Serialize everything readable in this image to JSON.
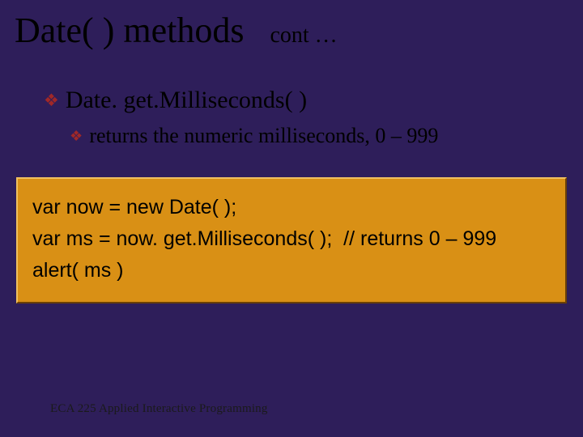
{
  "title": "Date( ) methods",
  "title_cont": "cont …",
  "bullet1": "Date. get.Milliseconds( )",
  "bullet2": "returns the numeric milliseconds, 0 – 999",
  "code": {
    "line1": "var now = new Date( );",
    "line2": "var ms = now. get.Milliseconds( );  // returns 0 – 999",
    "line3": "alert( ms )"
  },
  "footer": "ECA 225   Applied Interactive Programming"
}
